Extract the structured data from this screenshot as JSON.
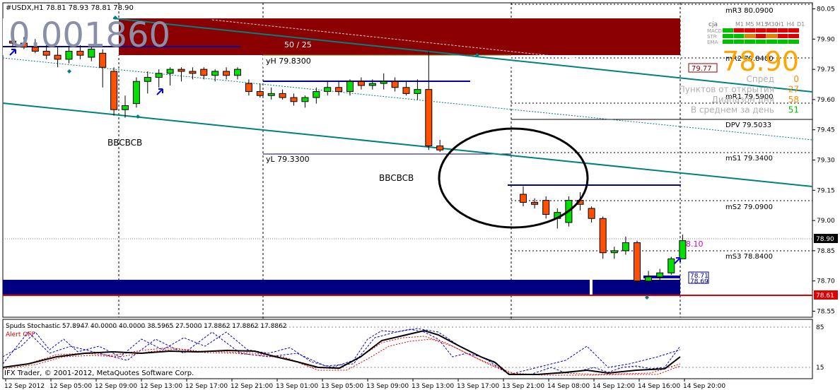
{
  "chart_header": {
    "symbol_line": "#USDX,H1  78.81 78.93 78.81 78.90"
  },
  "overlay": {
    "big_value": "0.001860",
    "box_label": "50 / 25",
    "yh_label": "yH 79.8300",
    "yl_label": "yL 79.3300",
    "pattern_label": "BBCBCB",
    "live_tag": "8.10",
    "box_tag_upper": "78.71",
    "box_tag_lower": "78.69",
    "tag_7977": "79.77"
  },
  "pivots": {
    "mR3": "mR3 80.0900",
    "mR2": "mR2 79.8400",
    "mR1": "mR1 79.5900",
    "dpv": "DPV 79.5033",
    "mS1": "mS1 79.3400",
    "mS2": "mS2 79.0900",
    "mS3": "mS3 78.8400"
  },
  "info_panel": {
    "pair": "cja",
    "timeframes": [
      "M1",
      "M5",
      "M15",
      "M30",
      "H1",
      "H4",
      "D1"
    ],
    "row_labels": [
      "MACD",
      "STR",
      "EMA"
    ],
    "price": "78.90",
    "rows": [
      {
        "label": "Спред",
        "value": "0",
        "color": "#ff8c00"
      },
      {
        "label": "Пунктов от открытия",
        "value": "-27",
        "color": "#ff8c00"
      },
      {
        "label": "Диапазон дня",
        "value": "58",
        "color": "#ff8c00"
      },
      {
        "label": "В среднем за день",
        "value": "51",
        "color": "#00c000"
      }
    ]
  },
  "price_axis": {
    "labels": [
      "80.05",
      "79.90",
      "79.75",
      "79.60",
      "79.45",
      "79.30",
      "79.15",
      "79.00",
      "78.85",
      "78.70",
      "78.55"
    ],
    "current_tag": "78.90",
    "red_tag": "78.61"
  },
  "time_axis": {
    "labels": [
      "12 Sep 2012",
      "12 Sep 05:00",
      "12 Sep 09:00",
      "12 Sep 13:00",
      "12 Sep 17:00",
      "12 Sep 21:00",
      "13 Sep 01:00",
      "13 Sep 05:00",
      "13 Sep 09:00",
      "13 Sep 13:00",
      "13 Sep 17:00",
      "13 Sep 21:00",
      "14 Sep 08:00",
      "14 Sep 12:00",
      "14 Sep 16:00",
      "14 Sep 20:00"
    ]
  },
  "indicator": {
    "title": "Spuds Stochastic 57.8947 40.0000 40.0000 38.5965 27.5000 17.8862 17.8862 17.8862",
    "alert": "Alert OFF",
    "levels": [
      "85",
      "15"
    ],
    "copyright": "IFX Trader, © 2001-2012, MetaQuotes Software Corp."
  },
  "colors": {
    "bull": "#00e000",
    "bear": "#ff5000",
    "box_red": "#8b0000",
    "box_blue": "#000080",
    "trend": "#008080",
    "level_blue": "#0000aa",
    "red_line": "#e00000"
  },
  "chart_data": {
    "type": "candlestick",
    "symbol": "#USDX",
    "timeframe": "H1",
    "ylim": [
      78.52,
      80.08
    ],
    "candles": [
      {
        "o": 79.89,
        "h": 79.92,
        "l": 79.86,
        "c": 79.88
      },
      {
        "o": 79.88,
        "h": 79.91,
        "l": 79.85,
        "c": 79.86
      },
      {
        "o": 79.86,
        "h": 79.9,
        "l": 79.83,
        "c": 79.84
      },
      {
        "o": 79.84,
        "h": 79.87,
        "l": 79.8,
        "c": 79.82
      },
      {
        "o": 79.82,
        "h": 79.86,
        "l": 79.76,
        "c": 79.8
      },
      {
        "o": 79.8,
        "h": 79.86,
        "l": 79.78,
        "c": 79.84
      },
      {
        "o": 79.84,
        "h": 79.87,
        "l": 79.8,
        "c": 79.82
      },
      {
        "o": 79.81,
        "h": 79.86,
        "l": 79.79,
        "c": 79.85
      },
      {
        "o": 79.83,
        "h": 79.85,
        "l": 79.66,
        "c": 79.76
      },
      {
        "o": 79.74,
        "h": 79.76,
        "l": 79.52,
        "c": 79.55
      },
      {
        "o": 79.55,
        "h": 79.62,
        "l": 79.51,
        "c": 79.57
      },
      {
        "o": 79.58,
        "h": 79.71,
        "l": 79.56,
        "c": 79.69
      },
      {
        "o": 79.69,
        "h": 79.74,
        "l": 79.63,
        "c": 79.71
      },
      {
        "o": 79.71,
        "h": 79.75,
        "l": 79.66,
        "c": 79.73
      },
      {
        "o": 79.73,
        "h": 79.76,
        "l": 79.67,
        "c": 79.75
      },
      {
        "o": 79.75,
        "h": 79.76,
        "l": 79.69,
        "c": 79.74
      },
      {
        "o": 79.74,
        "h": 79.76,
        "l": 79.7,
        "c": 79.73
      },
      {
        "o": 79.75,
        "h": 79.76,
        "l": 79.7,
        "c": 79.72
      },
      {
        "o": 79.72,
        "h": 79.75,
        "l": 79.69,
        "c": 79.74
      },
      {
        "o": 79.74,
        "h": 79.76,
        "l": 79.7,
        "c": 79.72
      },
      {
        "o": 79.72,
        "h": 79.76,
        "l": 79.7,
        "c": 79.75
      },
      {
        "o": 79.68,
        "h": 79.7,
        "l": 79.62,
        "c": 79.64
      },
      {
        "o": 79.64,
        "h": 79.68,
        "l": 79.61,
        "c": 79.62
      },
      {
        "o": 79.62,
        "h": 79.66,
        "l": 79.6,
        "c": 79.63
      },
      {
        "o": 79.63,
        "h": 79.65,
        "l": 79.6,
        "c": 79.61
      },
      {
        "o": 79.61,
        "h": 79.63,
        "l": 79.57,
        "c": 79.59
      },
      {
        "o": 79.59,
        "h": 79.62,
        "l": 79.56,
        "c": 79.61
      },
      {
        "o": 79.61,
        "h": 79.66,
        "l": 79.58,
        "c": 79.64
      },
      {
        "o": 79.64,
        "h": 79.69,
        "l": 79.62,
        "c": 79.66
      },
      {
        "o": 79.66,
        "h": 79.69,
        "l": 79.62,
        "c": 79.64
      },
      {
        "o": 79.64,
        "h": 79.7,
        "l": 79.62,
        "c": 79.69
      },
      {
        "o": 79.69,
        "h": 79.71,
        "l": 79.65,
        "c": 79.67
      },
      {
        "o": 79.67,
        "h": 79.7,
        "l": 79.65,
        "c": 79.68
      },
      {
        "o": 79.68,
        "h": 79.73,
        "l": 79.65,
        "c": 79.69
      },
      {
        "o": 79.69,
        "h": 79.71,
        "l": 79.64,
        "c": 79.66
      },
      {
        "o": 79.66,
        "h": 79.69,
        "l": 79.62,
        "c": 79.63
      },
      {
        "o": 79.63,
        "h": 79.7,
        "l": 79.6,
        "c": 79.65
      },
      {
        "o": 79.65,
        "h": 79.84,
        "l": 79.35,
        "c": 79.37
      },
      {
        "o": 79.37,
        "h": 79.4,
        "l": 79.34,
        "c": 79.35
      },
      {
        "o": 79.13,
        "h": 79.17,
        "l": 79.07,
        "c": 79.09
      },
      {
        "o": 79.09,
        "h": 79.11,
        "l": 79.06,
        "c": 79.08
      },
      {
        "o": 79.1,
        "h": 79.12,
        "l": 79.01,
        "c": 79.03
      },
      {
        "o": 79.01,
        "h": 79.06,
        "l": 78.96,
        "c": 79.04
      },
      {
        "o": 78.99,
        "h": 79.12,
        "l": 78.97,
        "c": 79.1
      },
      {
        "o": 79.1,
        "h": 79.14,
        "l": 79.05,
        "c": 79.08
      },
      {
        "o": 79.06,
        "h": 79.07,
        "l": 78.99,
        "c": 79.01
      },
      {
        "o": 79.01,
        "h": 79.02,
        "l": 78.81,
        "c": 78.84
      },
      {
        "o": 78.84,
        "h": 78.87,
        "l": 78.81,
        "c": 78.85
      },
      {
        "o": 78.85,
        "h": 78.92,
        "l": 78.83,
        "c": 78.89
      },
      {
        "o": 78.89,
        "h": 78.9,
        "l": 78.68,
        "c": 78.7
      },
      {
        "o": 78.7,
        "h": 78.75,
        "l": 78.68,
        "c": 78.72
      },
      {
        "o": 78.72,
        "h": 78.76,
        "l": 78.7,
        "c": 78.74
      },
      {
        "o": 78.74,
        "h": 78.82,
        "l": 78.73,
        "c": 78.81
      },
      {
        "o": 78.81,
        "h": 78.93,
        "l": 78.81,
        "c": 78.9
      }
    ]
  }
}
